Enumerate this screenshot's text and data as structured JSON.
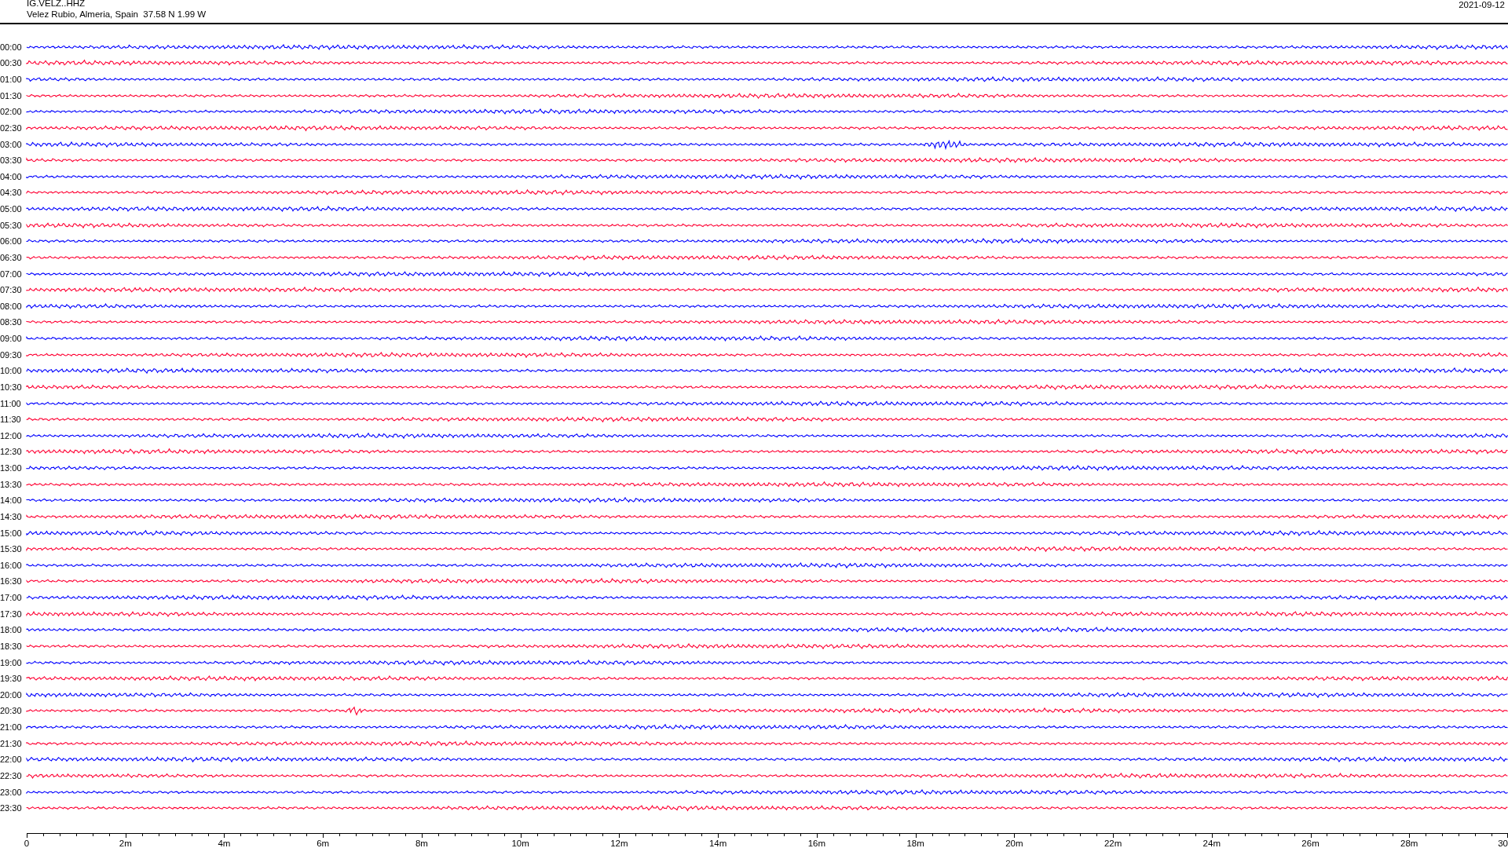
{
  "header": {
    "station": "IG.VELZ..HHZ",
    "location": "Velez Rubio, Almeria, Spain  37.58 N 1.99 W",
    "date": "2021-09-12"
  },
  "traces": [
    {
      "time": "00:00",
      "color": "#0000ff"
    },
    {
      "time": "00:30",
      "color": "#ff0033"
    },
    {
      "time": "01:00",
      "color": "#0000ff"
    },
    {
      "time": "01:30",
      "color": "#ff0033"
    },
    {
      "time": "02:00",
      "color": "#0000ff"
    },
    {
      "time": "02:30",
      "color": "#ff0033"
    },
    {
      "time": "03:00",
      "color": "#0000ff"
    },
    {
      "time": "03:30",
      "color": "#ff0033"
    },
    {
      "time": "04:00",
      "color": "#0000ff"
    },
    {
      "time": "04:30",
      "color": "#ff0033"
    },
    {
      "time": "05:00",
      "color": "#0000ff"
    },
    {
      "time": "05:30",
      "color": "#ff0033"
    },
    {
      "time": "06:00",
      "color": "#0000ff"
    },
    {
      "time": "06:30",
      "color": "#ff0033"
    },
    {
      "time": "07:00",
      "color": "#0000ff"
    },
    {
      "time": "07:30",
      "color": "#ff0033"
    },
    {
      "time": "08:00",
      "color": "#0000ff"
    },
    {
      "time": "08:30",
      "color": "#ff0033"
    },
    {
      "time": "09:00",
      "color": "#0000ff"
    },
    {
      "time": "09:30",
      "color": "#ff0033"
    },
    {
      "time": "10:00",
      "color": "#0000ff"
    },
    {
      "time": "10:30",
      "color": "#ff0033"
    },
    {
      "time": "11:00",
      "color": "#0000ff"
    },
    {
      "time": "11:30",
      "color": "#ff0033"
    },
    {
      "time": "12:00",
      "color": "#0000ff"
    },
    {
      "time": "12:30",
      "color": "#ff0033"
    },
    {
      "time": "13:00",
      "color": "#0000ff"
    },
    {
      "time": "13:30",
      "color": "#ff0033"
    },
    {
      "time": "14:00",
      "color": "#0000ff"
    },
    {
      "time": "14:30",
      "color": "#ff0033"
    },
    {
      "time": "15:00",
      "color": "#0000ff"
    },
    {
      "time": "15:30",
      "color": "#ff0033"
    },
    {
      "time": "16:00",
      "color": "#0000ff"
    },
    {
      "time": "16:30",
      "color": "#ff0033"
    },
    {
      "time": "17:00",
      "color": "#0000ff"
    },
    {
      "time": "17:30",
      "color": "#ff0033"
    },
    {
      "time": "18:00",
      "color": "#0000ff"
    },
    {
      "time": "18:30",
      "color": "#ff0033"
    },
    {
      "time": "19:00",
      "color": "#0000ff"
    },
    {
      "time": "19:30",
      "color": "#ff0033"
    },
    {
      "time": "20:00",
      "color": "#0000ff"
    },
    {
      "time": "20:30",
      "color": "#ff0033"
    },
    {
      "time": "21:00",
      "color": "#0000ff"
    },
    {
      "time": "21:30",
      "color": "#ff0033"
    },
    {
      "time": "22:00",
      "color": "#0000ff"
    },
    {
      "time": "22:30",
      "color": "#ff0033"
    },
    {
      "time": "23:00",
      "color": "#0000ff"
    },
    {
      "time": "23:30",
      "color": "#ff0033"
    }
  ],
  "time_axis": {
    "labels": [
      "0",
      "2m",
      "4m",
      "6m",
      "8m",
      "10m",
      "12m",
      "14m",
      "16m",
      "18m",
      "20m",
      "22m",
      "24m",
      "26m",
      "28m",
      "30"
    ]
  }
}
